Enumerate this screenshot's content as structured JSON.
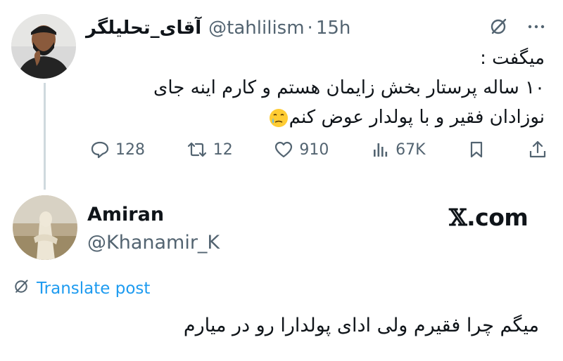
{
  "tweet": {
    "display_name": "آقای_تحلیلگر",
    "handle": "@tahlilism",
    "separator": "·",
    "time": "15h",
    "text_lines": [
      "میگفت :",
      "۱۰ ساله پرستار بخش زایمان هستم و کارم اینه جای",
      "نوزادان فقیر و با پولدار عوض کنم"
    ],
    "emoji": "face-holding-back-tears",
    "top_icons": [
      "grok-icon",
      "more-icon"
    ],
    "actions": {
      "replies": "128",
      "retweets": "12",
      "likes": "910",
      "views": "67K"
    }
  },
  "quote": {
    "display_name": "Amiran",
    "handle": "@Khanamir_K",
    "brand": ".com",
    "brand_mark": "𝕏",
    "translate_label": "Translate post",
    "text": "میگم چرا فقیرم ولی ادای پولدارا رو در میارم"
  },
  "colors": {
    "text": "#0f1419",
    "secondary": "#536471",
    "link": "#1d9bf0",
    "thread_line": "#cfd9de"
  }
}
